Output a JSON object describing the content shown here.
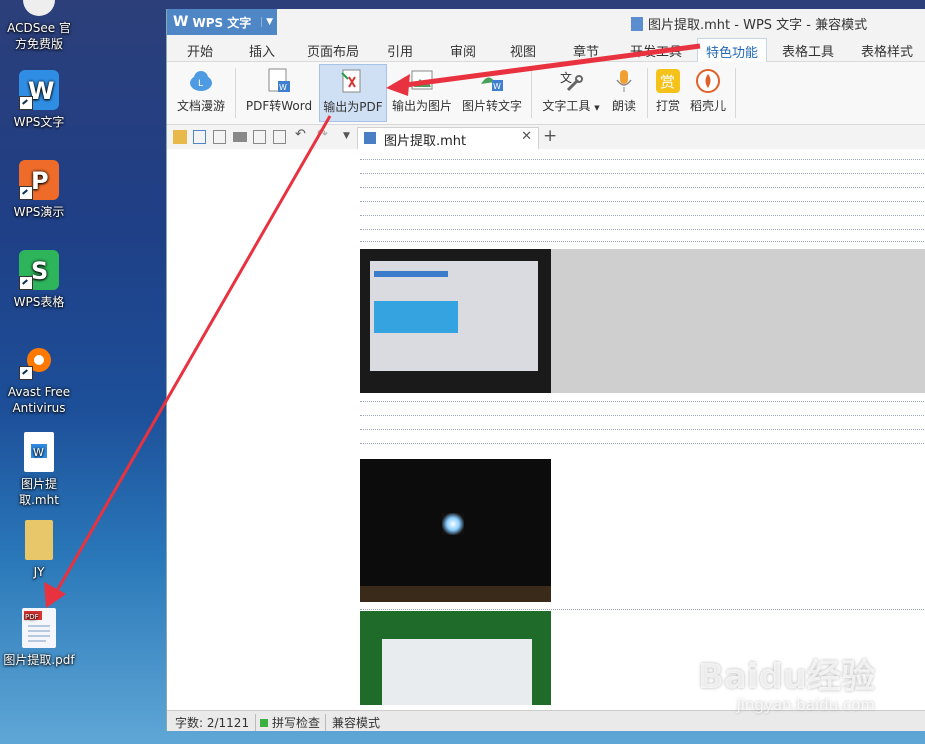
{
  "desktop": {
    "icons": [
      {
        "label": "ACDSee 官方免费版"
      },
      {
        "label": "WPS文字"
      },
      {
        "label": "WPS演示"
      },
      {
        "label": "WPS表格"
      },
      {
        "label": "Avast Free Antivirus"
      },
      {
        "label": "图片提取.mht"
      },
      {
        "label": "JY"
      },
      {
        "label": "图片提取.pdf"
      }
    ],
    "watermark": {
      "main": "Baidu经验",
      "sub": "jingyan.baidu.com"
    }
  },
  "window": {
    "app_button": "WPS 文字",
    "title": "图片提取.mht - WPS 文字 - 兼容模式"
  },
  "menu": {
    "items": [
      "开始",
      "插入",
      "页面布局",
      "引用",
      "审阅",
      "视图",
      "章节",
      "开发工具",
      "特色功能",
      "表格工具",
      "表格样式"
    ],
    "active": "特色功能"
  },
  "ribbon": {
    "buttons": [
      "文档漫游",
      "PDF转Word",
      "输出为PDF",
      "输出为图片",
      "图片转文字",
      "文字工具",
      "朗读",
      "打赏",
      "稻壳儿"
    ]
  },
  "tabs": {
    "document": "图片提取.mht"
  },
  "status": {
    "word_count": "字数: 2/1121",
    "spell_check": "拼写检查",
    "mode": "兼容模式"
  },
  "colors": {
    "accent": "#4f86c6",
    "active_tab": "#1f67b3",
    "arrow": "#e8323f"
  }
}
